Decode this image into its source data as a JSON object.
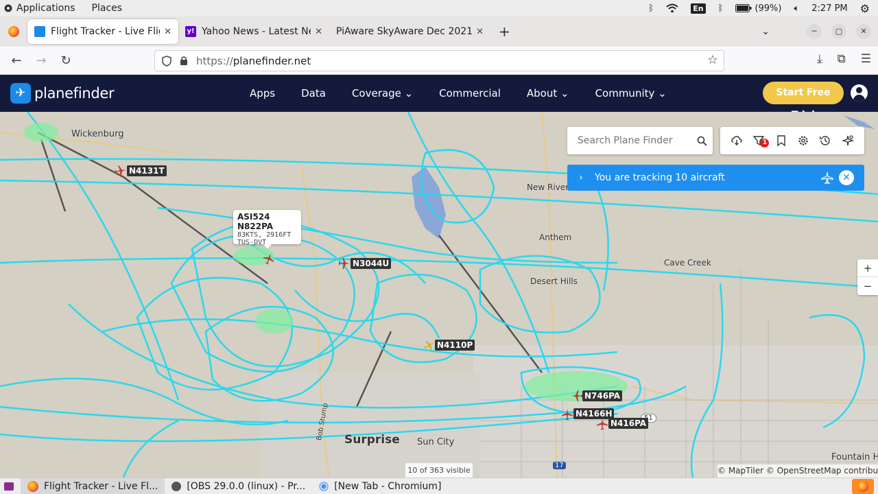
{
  "os": {
    "applications": "Applications",
    "places": "Places",
    "battery": "(99%)",
    "time": "2:27 PM",
    "lang": "En"
  },
  "tabs": [
    {
      "title": "Flight Tracker - Live Flight",
      "close": "✕"
    },
    {
      "title": "Yahoo News - Latest New",
      "close": "✕"
    },
    {
      "title": "PiAware SkyAware Dec 2021",
      "close": "✕"
    }
  ],
  "newtab": "+",
  "url": {
    "proto": "https://",
    "host": "planefinder.net"
  },
  "site": {
    "logo": "planefinder",
    "nav": [
      "Apps",
      "Data",
      "Coverage ⌄",
      "Commercial",
      "About ⌄",
      "Community ⌄"
    ],
    "cta": "Start Free Trial"
  },
  "map": {
    "places": [
      "Wickenburg",
      "New River",
      "Anthem",
      "Cave Creek",
      "Desert Hills",
      "Surprise",
      "Sun City",
      "Fountain Hi",
      "Bob Stump",
      "51",
      "17"
    ],
    "popup": {
      "line1": "ASI524 N822PA",
      "line2": "83KTS, 2916FT",
      "line3": "TUS-DVT"
    },
    "aircraft": [
      "N4131T",
      "N3044U",
      "N4110P",
      "N746PA",
      "N4166H",
      "N416PA"
    ],
    "search_placeholder": "Search Plane Finder",
    "filter_badge": "1",
    "tracking": "You are tracking 10 aircraft",
    "visible": "10 of 363 visible",
    "attribution": "© MapTiler © OpenStreetMap contributors",
    "zoom_in": "+",
    "zoom_out": "−"
  },
  "taskbar": [
    {
      "title": "Flight Tracker - Live Fl..."
    },
    {
      "title": "[OBS 29.0.0 (linux) - Pr..."
    },
    {
      "title": "[New Tab - Chromium]"
    }
  ],
  "colors": {
    "header": "#141a3c",
    "cta": "#f2c84b",
    "track": "#22d8f0",
    "tracking_bar": "#1f8fef"
  }
}
